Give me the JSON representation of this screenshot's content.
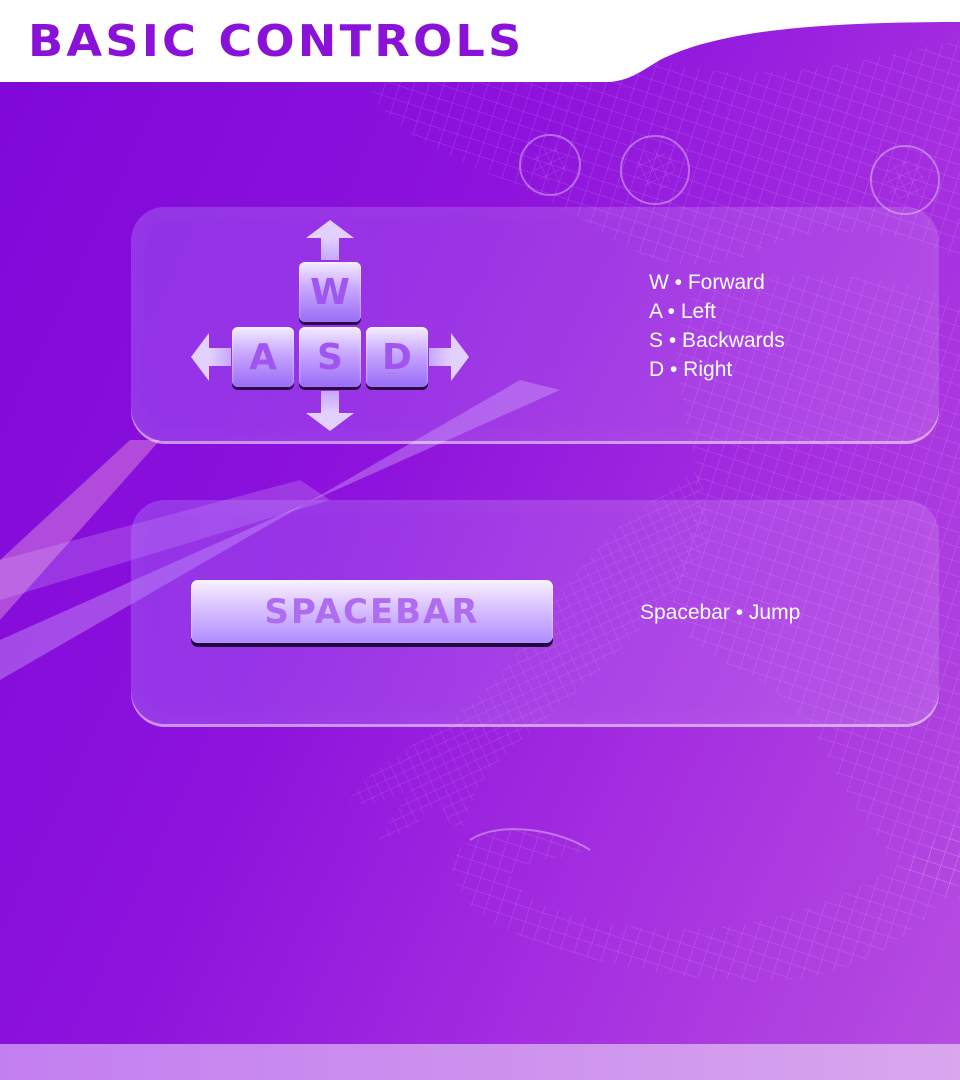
{
  "header": {
    "title": "BASIC CONTROLS"
  },
  "movement": {
    "keys": [
      "W",
      "A",
      "S",
      "D"
    ],
    "legend": [
      "W • Forward",
      "A • Left",
      "S • Backwards",
      "D • Right"
    ]
  },
  "jump": {
    "key_label": "SPACEBAR",
    "legend": "Spacebar • Jump"
  },
  "colors": {
    "background": "#8a0fdc",
    "title_text": "#8a12d8",
    "key_face": "#c7a6ff",
    "key_letter": "#a055f0",
    "footer": "#cf95ee"
  },
  "icons": {
    "up": "arrow-up-icon",
    "down": "arrow-down-icon",
    "left": "arrow-left-icon",
    "right": "arrow-right-icon",
    "background_art": "wireframe-creature-graphic"
  }
}
